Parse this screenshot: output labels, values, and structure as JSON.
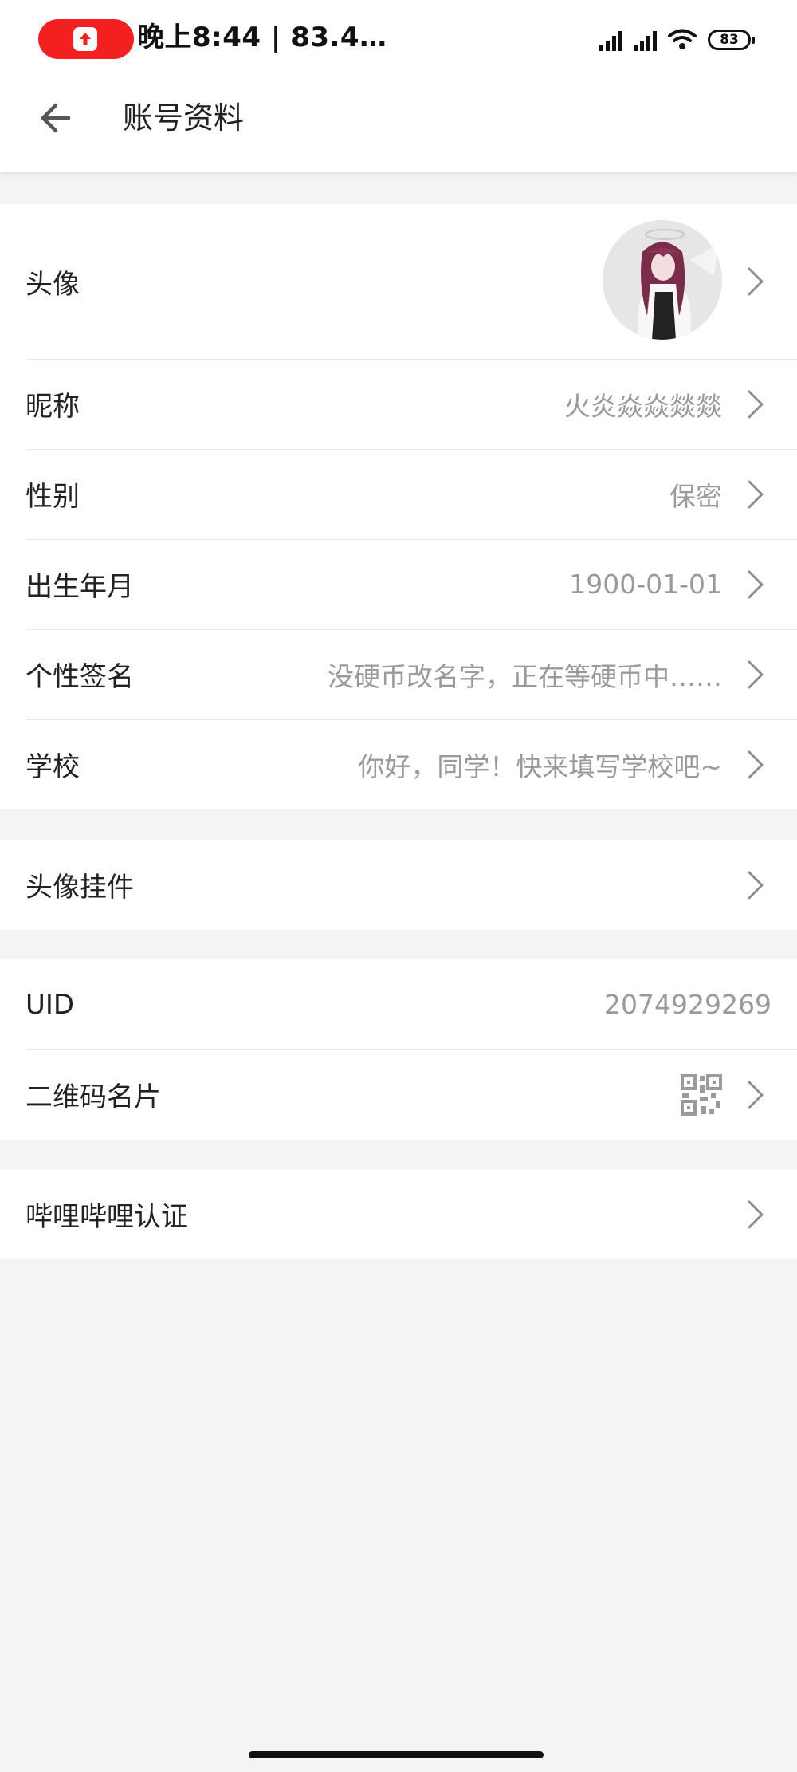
{
  "status_bar": {
    "time_text": "晚上8:44 | 83.4…",
    "battery_level": "83",
    "record_color": "#f41f1f"
  },
  "header": {
    "back_icon": "arrow-left-icon",
    "title": "账号资料"
  },
  "profile_group": {
    "rows": [
      {
        "label": "头像",
        "value": ""
      },
      {
        "label": "昵称",
        "value": "火炎焱焱燚燚"
      },
      {
        "label": "性别",
        "value": "保密"
      },
      {
        "label": "出生年月",
        "value": "1900-01-01"
      },
      {
        "label": "个性签名",
        "value": "没硬币改名字，正在等硬币中……"
      },
      {
        "label": "学校",
        "value": "你好，同学！快来填写学校吧~"
      }
    ]
  },
  "pendant_group": {
    "label": "头像挂件"
  },
  "id_group": {
    "uid_label": "UID",
    "uid_value": "2074929269",
    "qr_label": "二维码名片"
  },
  "verify_group": {
    "label": "哔哩哔哩认证"
  },
  "icons": {
    "chevron": "chevron-right-icon",
    "qr": "qr-code-icon",
    "wifi": "wifi-icon",
    "signal": "signal-icon"
  },
  "colors": {
    "background": "#f4f4f4",
    "card": "#ffffff",
    "label_text": "#222222",
    "value_text": "#9a9a9a"
  }
}
